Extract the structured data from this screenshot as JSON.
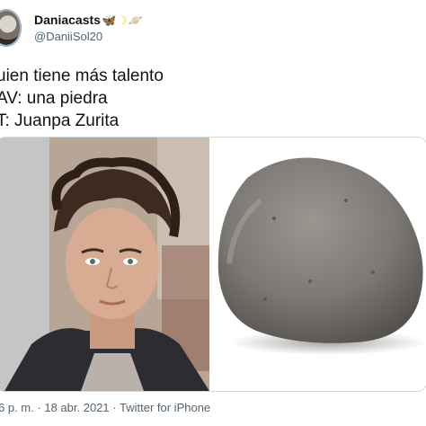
{
  "user": {
    "display_name": "Daniacasts",
    "emoji_1": "🦋",
    "emoji_2": "☽",
    "emoji_3": "🪐",
    "handle": "@DaniiSol20"
  },
  "tweet": {
    "lines": [
      "uien tiene más talento",
      "AV: una piedra",
      "T: Juanpa Zurita"
    ]
  },
  "media": {
    "left_image": "portrait-photo",
    "right_image": "stone-photo"
  },
  "meta": {
    "time": "6 p. m.",
    "separator": "·",
    "date": "18 abr. 2021",
    "app": "Twitter for iPhone"
  }
}
